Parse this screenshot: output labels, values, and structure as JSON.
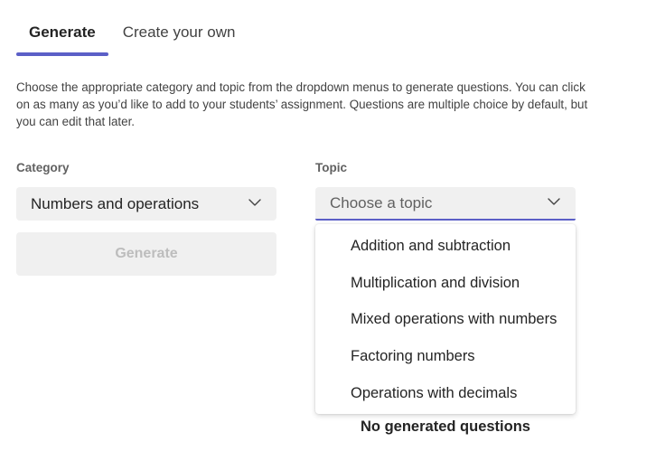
{
  "tabs": [
    {
      "label": "Generate",
      "active": true
    },
    {
      "label": "Create your own",
      "active": false
    }
  ],
  "description": "Choose the appropriate category and topic from the dropdown menus to generate questions. You can click on as many as you’d like to add to your students’ assignment. Questions are multiple choice by default, but you can edit that later.",
  "category": {
    "label": "Category",
    "value": "Numbers and operations",
    "icon": "chevron-down-icon"
  },
  "topic": {
    "label": "Topic",
    "placeholder": "Choose a topic",
    "icon": "chevron-down-icon",
    "options": [
      "Addition and subtraction",
      "Multiplication and division",
      "Mixed operations with numbers",
      "Factoring numbers",
      "Operations with decimals"
    ]
  },
  "generate_button": {
    "label": "Generate",
    "enabled": false
  },
  "empty_state": "No generated questions",
  "colors": {
    "accent": "#5b5fc7",
    "field_background": "#f0f0f0",
    "disabled_text": "#bdbdbd"
  }
}
